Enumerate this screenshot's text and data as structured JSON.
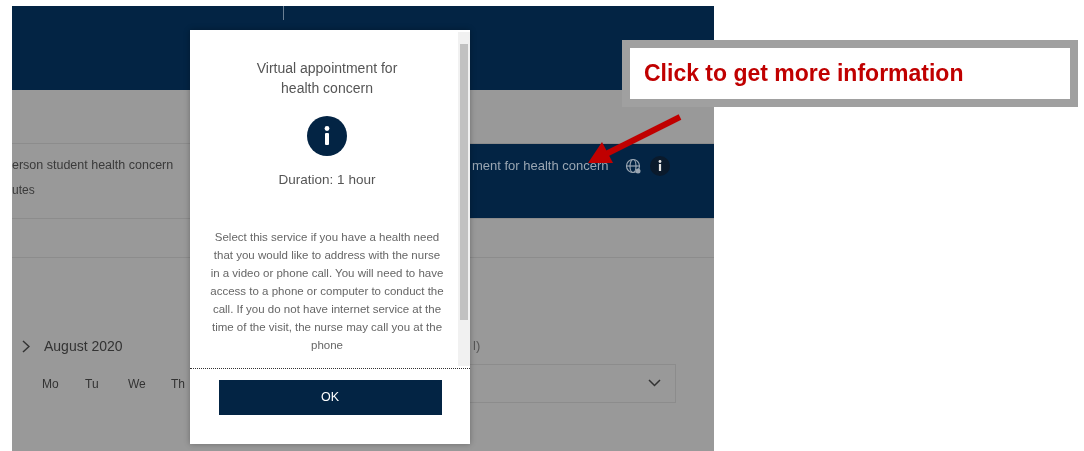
{
  "services": [
    {
      "name": "erson student health concern",
      "duration": "utes",
      "selected": false
    },
    {
      "name": "ment for health concern",
      "selected": true
    }
  ],
  "calendar": {
    "month": "August 2020",
    "weekdays": [
      "Mo",
      "Tu",
      "We",
      "Th"
    ]
  },
  "time_panel": {
    "label": "l)"
  },
  "modal": {
    "title": "Virtual appointment for health concern",
    "duration": "Duration: 1 hour",
    "description": "Select this service if you have a health need that you would like to address with the nurse in a video or phone call. You will need to have access to a phone or computer to conduct the call. If you do not have internet service at the time of the visit, the nurse may call you at the phone",
    "button": "OK"
  },
  "callout": {
    "text": "Click to get more information"
  }
}
